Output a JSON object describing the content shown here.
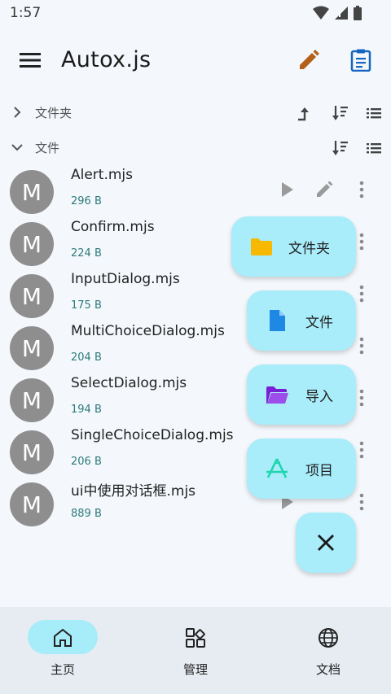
{
  "status": {
    "time": "1:57"
  },
  "app": {
    "title": "Autox.js"
  },
  "sections": {
    "folders_label": "文件夹",
    "files_label": "文件"
  },
  "files": [
    {
      "name": "Alert.mjs",
      "size": "296 B",
      "avatar": "M"
    },
    {
      "name": "Confirm.mjs",
      "size": "224 B",
      "avatar": "M"
    },
    {
      "name": "InputDialog.mjs",
      "size": "175 B",
      "avatar": "M"
    },
    {
      "name": "MultiChoiceDialog.mjs",
      "size": "204 B",
      "avatar": "M"
    },
    {
      "name": "SelectDialog.mjs",
      "size": "194 B",
      "avatar": "M"
    },
    {
      "name": "SingleChoiceDialog.mjs",
      "size": "206 B",
      "avatar": "M"
    },
    {
      "name": "ui中使用对话框.mjs",
      "size": "889 B",
      "avatar": "M"
    }
  ],
  "fab_menu": {
    "folder": "文件夹",
    "file": "文件",
    "import": "导入",
    "project": "项目"
  },
  "nav": {
    "home": "主页",
    "manage": "管理",
    "docs": "文档"
  },
  "colors": {
    "accent": "#a9ecfa",
    "folder": "#f7b900",
    "file": "#1e88e5",
    "import": "#7b1fd6",
    "project": "#1ed6b0",
    "edit": "#b3601a",
    "clipboard": "#1565c0"
  }
}
